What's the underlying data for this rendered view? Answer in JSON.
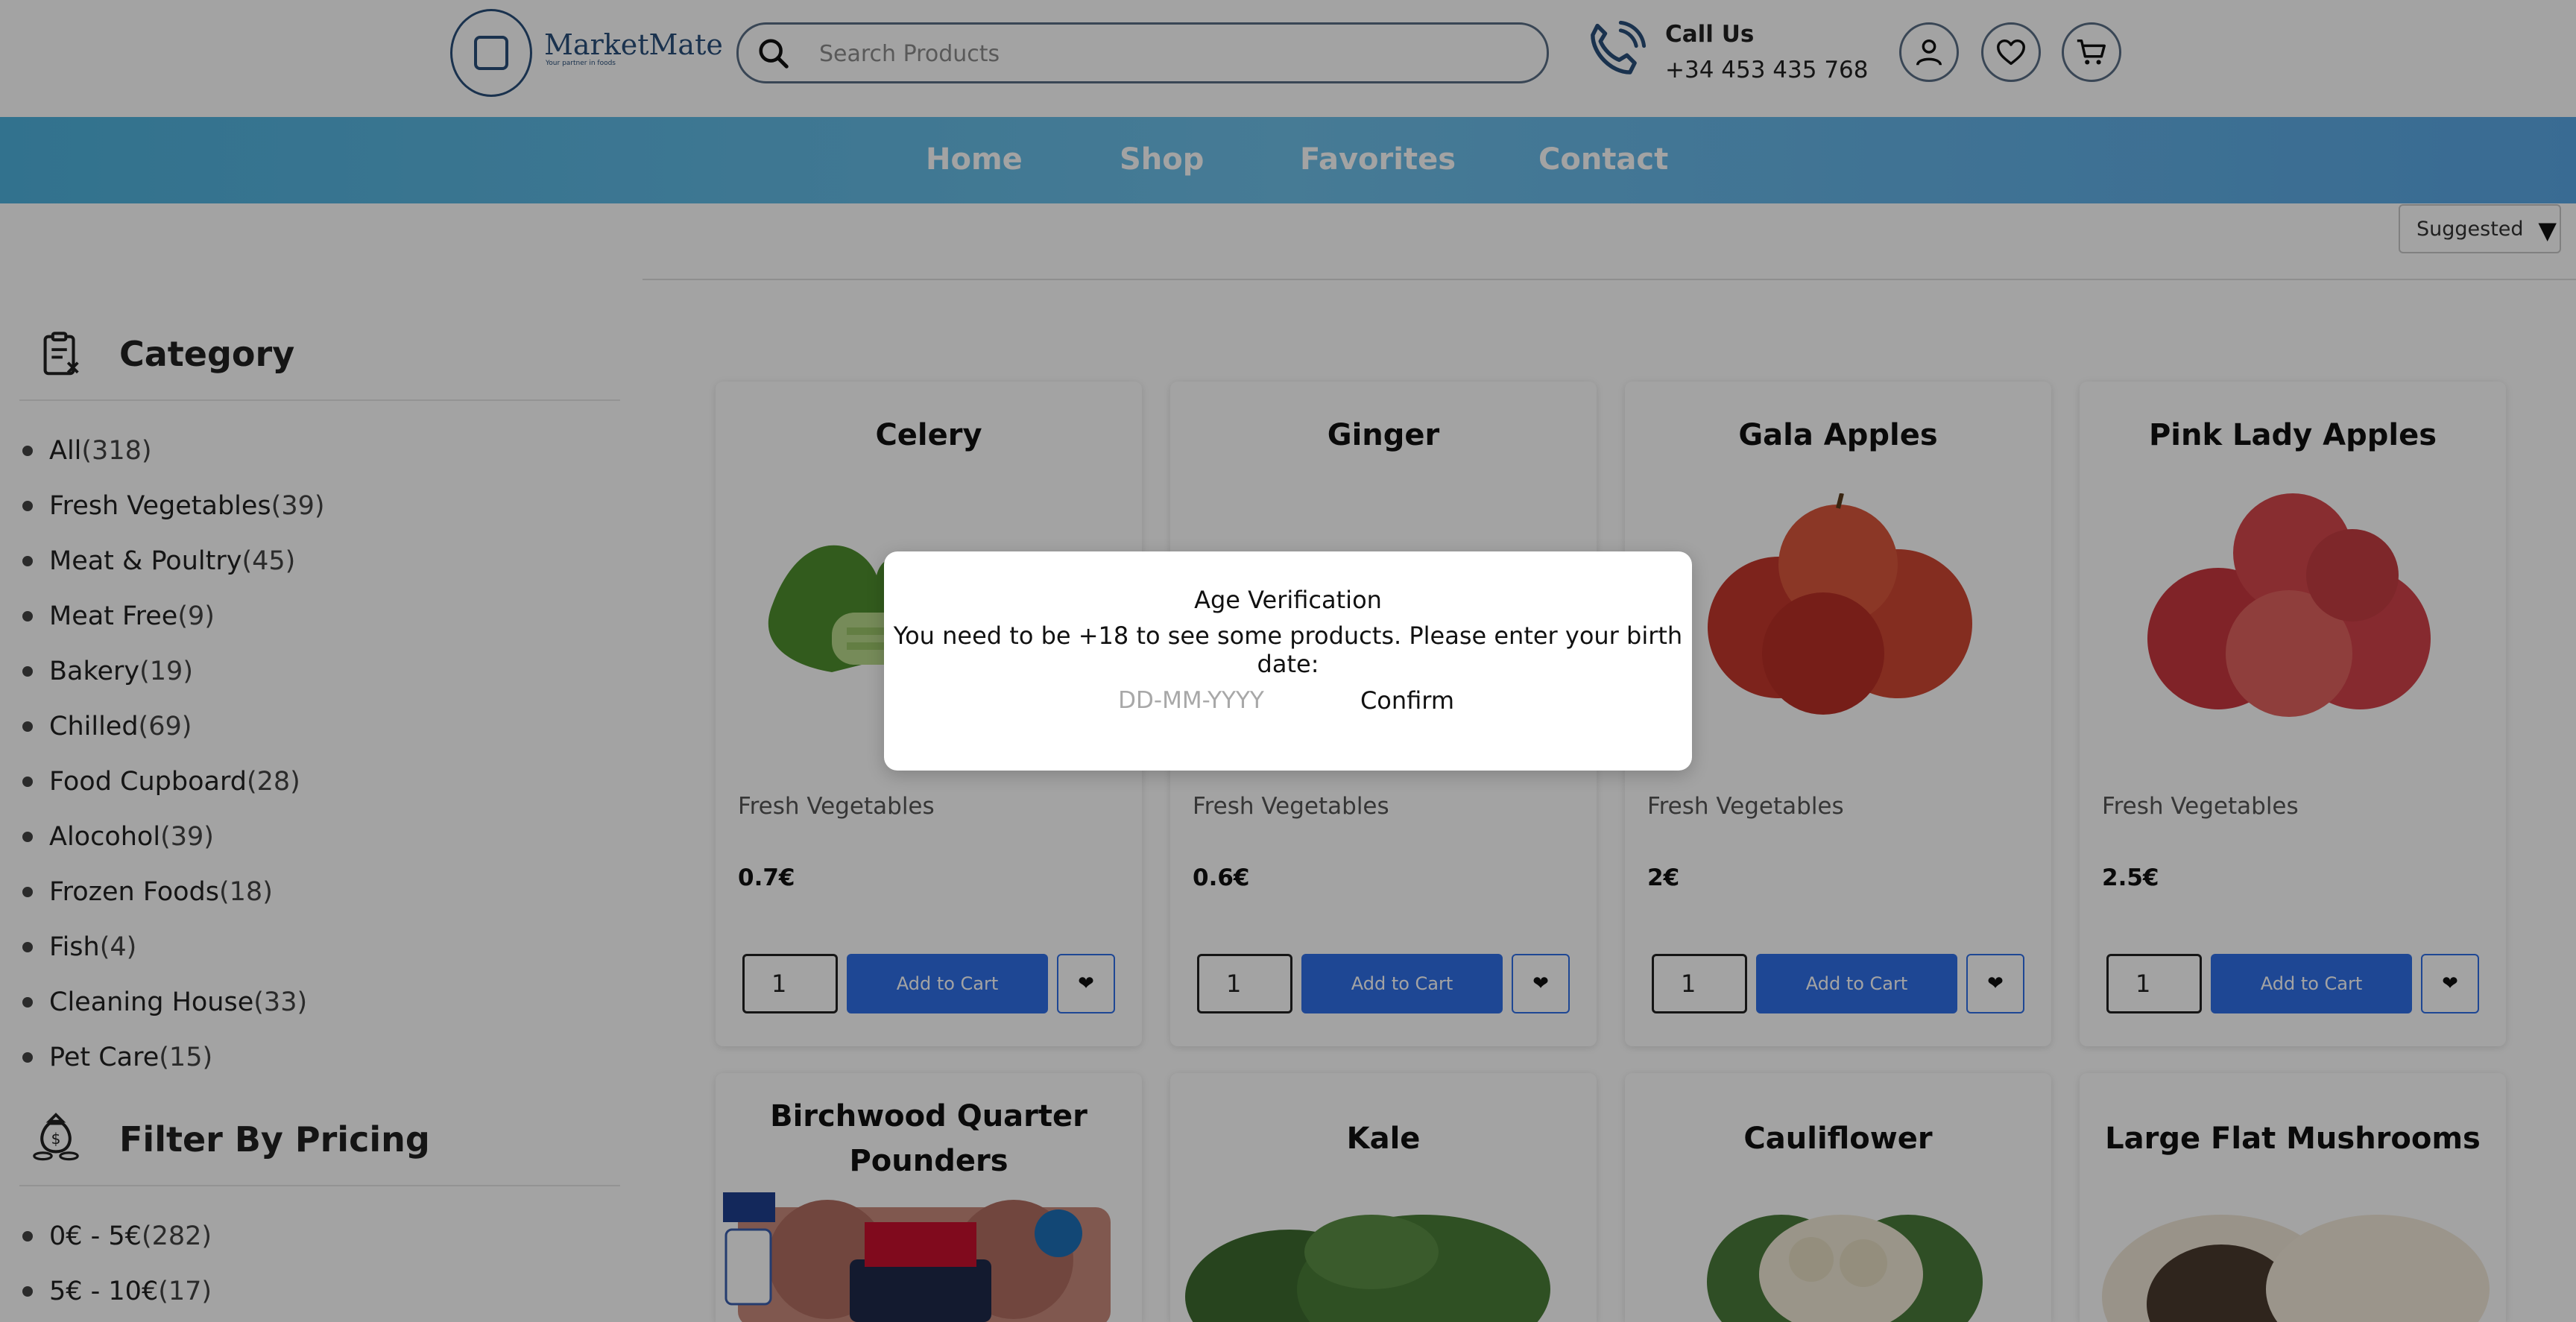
{
  "header": {
    "logo_name": "MarketMate",
    "logo_tagline": "Your partner in foods",
    "search_placeholder": "Search Products",
    "call_label": "Call Us",
    "call_number": "+34 453 435 768"
  },
  "nav": {
    "items": [
      "Home",
      "Shop",
      "Favorites",
      "Contact"
    ]
  },
  "sort": {
    "selected": "Suggested",
    "arrow": "▼"
  },
  "sidebar": {
    "category_title": "Category",
    "categories": [
      {
        "label": "All",
        "count": "(318)"
      },
      {
        "label": "Fresh Vegetables",
        "count": "(39)"
      },
      {
        "label": "Meat & Poultry",
        "count": "(45)"
      },
      {
        "label": "Meat Free",
        "count": "(9)"
      },
      {
        "label": "Bakery",
        "count": "(19)"
      },
      {
        "label": "Chilled",
        "count": "(69)"
      },
      {
        "label": "Food Cupboard",
        "count": "(28)"
      },
      {
        "label": "Alocohol",
        "count": "(39)"
      },
      {
        "label": "Frozen Foods",
        "count": "(18)"
      },
      {
        "label": "Fish",
        "count": "(4)"
      },
      {
        "label": "Cleaning House",
        "count": "(33)"
      },
      {
        "label": "Pet Care",
        "count": "(15)"
      }
    ],
    "pricing_title": "Filter By Pricing",
    "price_ranges": [
      {
        "label": "0€ - 5€",
        "count": "(282)"
      },
      {
        "label": "5€ - 10€",
        "count": "(17)"
      }
    ]
  },
  "products": [
    {
      "name": "Celery",
      "category": "Fresh Vegetables",
      "price": "0.7€",
      "qty": "1",
      "add_label": "Add to Cart",
      "fav_icon": "❤"
    },
    {
      "name": "Ginger",
      "category": "Fresh Vegetables",
      "price": "0.6€",
      "qty": "1",
      "add_label": "Add to Cart",
      "fav_icon": "❤"
    },
    {
      "name": "Gala Apples",
      "category": "Fresh Vegetables",
      "price": "2€",
      "qty": "1",
      "add_label": "Add to Cart",
      "fav_icon": "❤"
    },
    {
      "name": "Pink Lady Apples",
      "category": "Fresh Vegetables",
      "price": "2.5€",
      "qty": "1",
      "add_label": "Add to Cart",
      "fav_icon": "❤"
    },
    {
      "name": "Birchwood Quarter Pounders"
    },
    {
      "name": "Kale"
    },
    {
      "name": "Cauliflower"
    },
    {
      "name": "Large Flat Mushrooms"
    }
  ],
  "modal": {
    "title": "Age Verification",
    "message": "You need to be +18 to see some products. Please enter your birth date:",
    "input_placeholder": "DD-MM-YYYY",
    "confirm_label": "Confirm"
  },
  "colors": {
    "nav_gradient_start": "#4fb3de",
    "nav_gradient_end": "#5aa8e6",
    "add_button": "#2f6fe8",
    "brand": "#2a4f7a"
  }
}
